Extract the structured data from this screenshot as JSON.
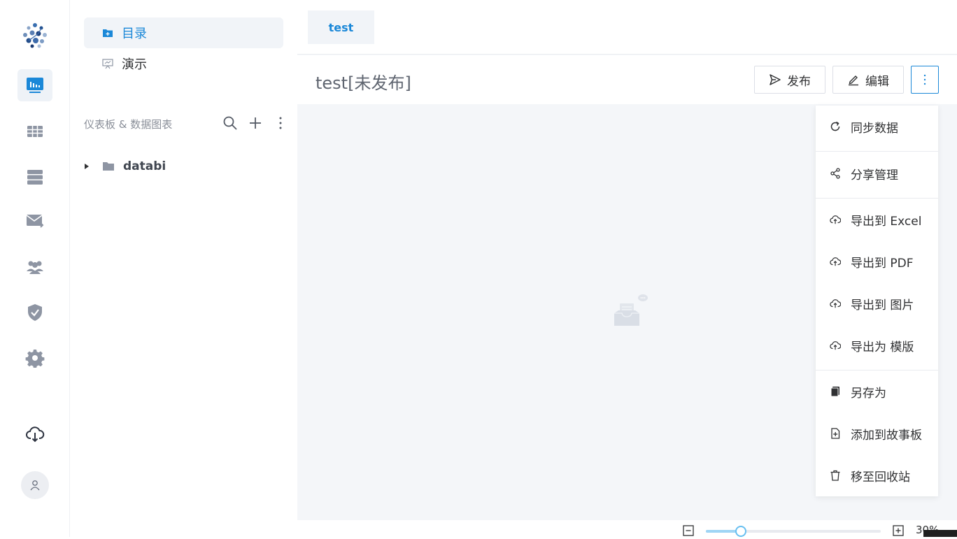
{
  "sidebar": {
    "items": [
      {
        "name": "dashboard",
        "icon": "dashboard-icon",
        "active": true
      },
      {
        "name": "table",
        "icon": "table-icon"
      },
      {
        "name": "datasource",
        "icon": "database-icon"
      },
      {
        "name": "mail",
        "icon": "mail-forward-icon"
      },
      {
        "name": "users",
        "icon": "users-icon"
      },
      {
        "name": "security",
        "icon": "shield-icon"
      },
      {
        "name": "settings",
        "icon": "gear-icon"
      },
      {
        "name": "download",
        "icon": "cloud-download-icon"
      }
    ]
  },
  "tree": {
    "nav": [
      {
        "label": "目录",
        "icon": "folder-icon",
        "active": true
      },
      {
        "label": "演示",
        "icon": "presentation-icon",
        "active": false
      }
    ],
    "section_label": "仪表板 & 数据图表",
    "folders": [
      {
        "label": "databi",
        "expanded": false
      }
    ]
  },
  "tabs": [
    {
      "label": "test",
      "active": true
    }
  ],
  "header": {
    "title": "test[未发布]",
    "publish_label": "发布",
    "edit_label": "编辑"
  },
  "menu": {
    "items": [
      {
        "label": "同步数据",
        "icon": "refresh-icon"
      },
      {
        "label": "分享管理",
        "icon": "share-icon"
      },
      {
        "label": "导出到 Excel",
        "icon": "cloud-upload-icon"
      },
      {
        "label": "导出到 PDF",
        "icon": "cloud-upload-icon"
      },
      {
        "label": "导出到 图片",
        "icon": "cloud-upload-icon"
      },
      {
        "label": "导出为 模版",
        "icon": "cloud-upload-icon"
      },
      {
        "label": "另存为",
        "icon": "copy-icon"
      },
      {
        "label": "添加到故事板",
        "icon": "file-add-icon"
      },
      {
        "label": "移至回收站",
        "icon": "trash-icon"
      }
    ]
  },
  "zoom": {
    "value_label": "30%",
    "level": 0.2
  },
  "colors": {
    "accent": "#1b88d8",
    "canvas_bg": "#f4f6f9",
    "icon_gray": "#8e95a3"
  }
}
